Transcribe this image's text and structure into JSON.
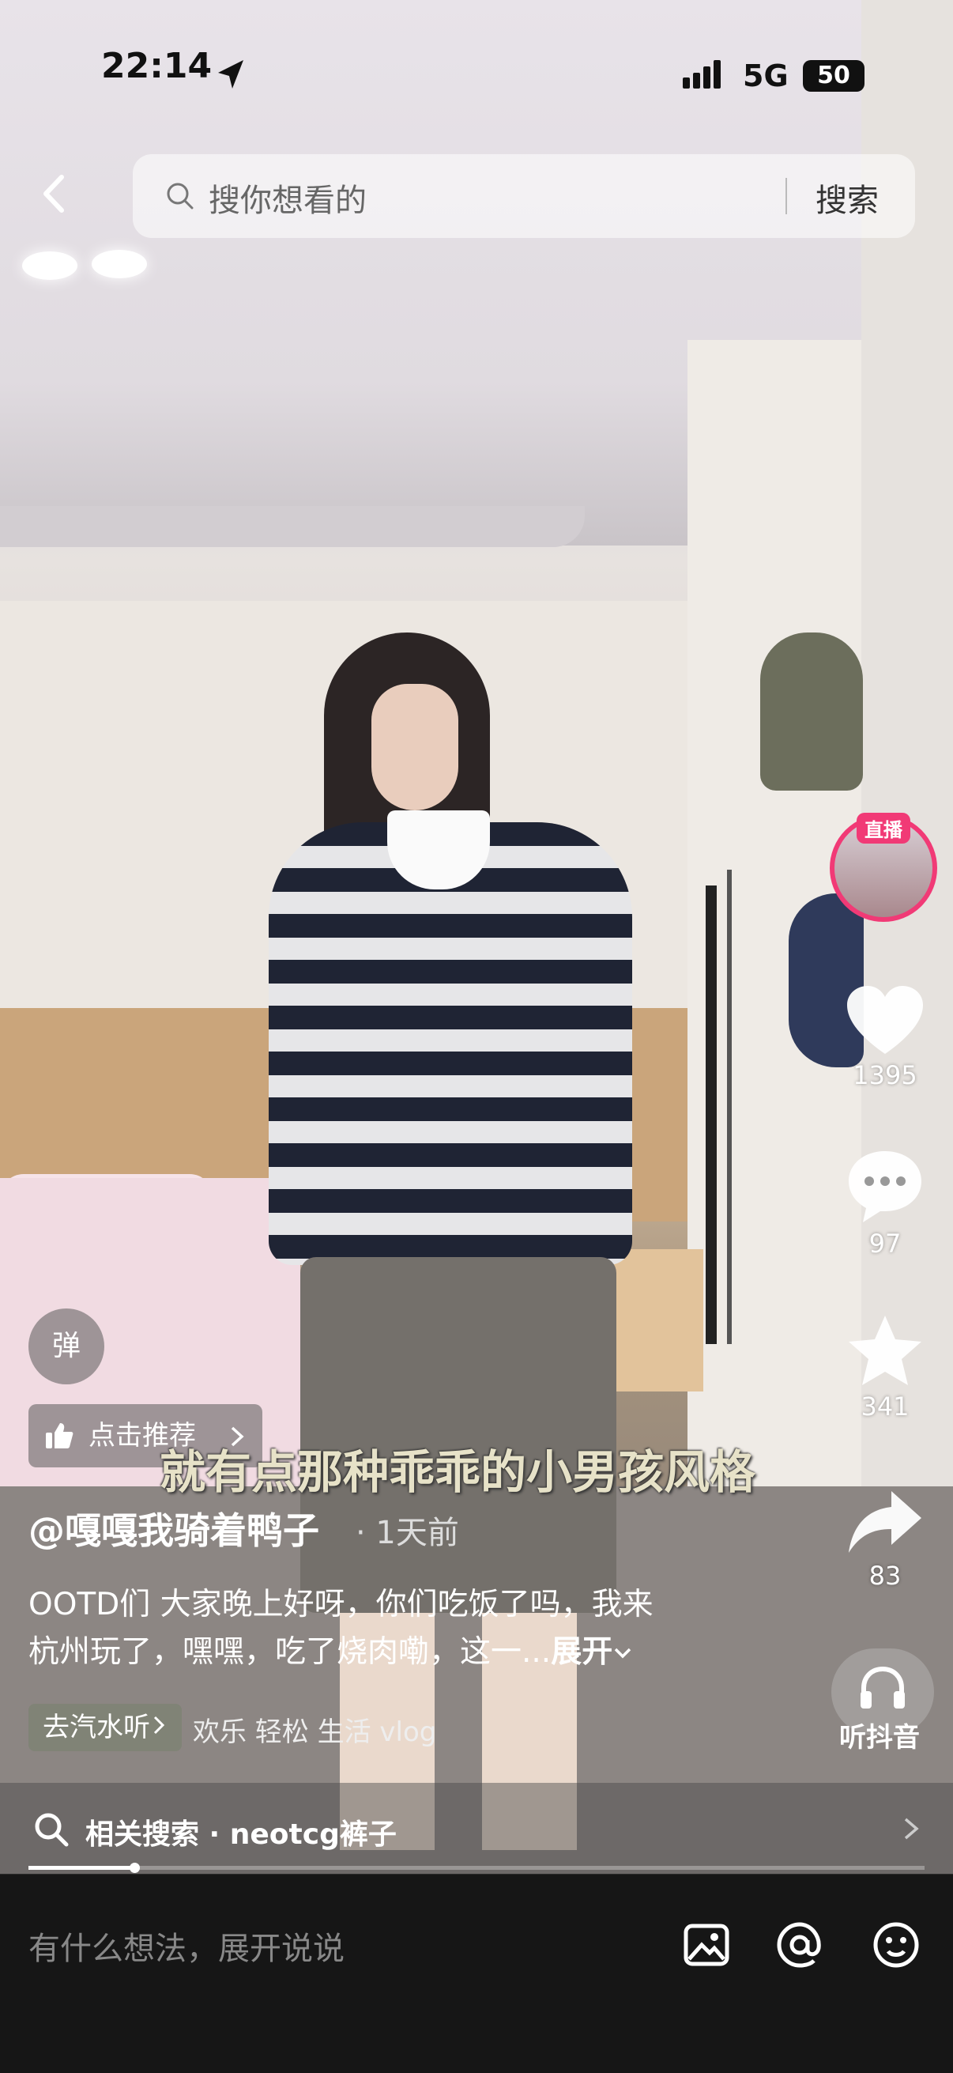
{
  "status_bar": {
    "time": "22:14",
    "network": "5G",
    "battery": "50"
  },
  "search": {
    "placeholder": "搜你想看的",
    "button": "搜索"
  },
  "sidebar": {
    "live_label": "直播",
    "like_count": "1395",
    "comment_count": "97",
    "favorite_count": "341",
    "share_count": "83",
    "listen_label": "听抖音"
  },
  "overlay": {
    "danmu_label": "弹",
    "recommend_label": "点击推荐",
    "subtitle": "就有点那种乖乖的小男孩风格"
  },
  "post": {
    "author": "@嘎嘎我骑着鸭子",
    "time": "· 1天前",
    "description_line1": "OOTD们 大家晚上好呀，你们吃饭了吗，我来",
    "description_line2": "杭州玩了，嘿嘿，吃了烧肉嘞，这一...",
    "expand_label": "展开",
    "music_pill": "去汽水听",
    "tags": "欢乐 轻松 生活 vlog"
  },
  "related_search": {
    "label": "相关搜索",
    "term": "neotcg裤子"
  },
  "progress": {
    "fraction": 0.118
  },
  "comment_bar": {
    "placeholder": "有什么想法，展开说说"
  },
  "icons": [
    "back-arrow-icon",
    "search-icon",
    "location-arrow-icon",
    "signal-icon",
    "heart-icon",
    "comment-icon",
    "star-icon",
    "share-icon",
    "headphones-icon",
    "thumbs-up-icon",
    "image-icon",
    "at-icon",
    "emoji-icon",
    "chevron-right-icon",
    "chevron-down-icon"
  ],
  "colors": {
    "live_accent": "#f13a76",
    "background": "#161616"
  }
}
